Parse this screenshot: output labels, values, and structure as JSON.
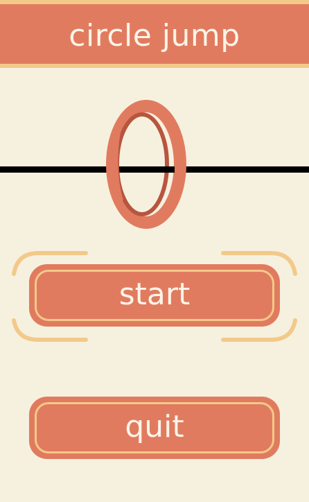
{
  "header": {
    "title": "circle jump"
  },
  "menu": {
    "start_label": "start",
    "quit_label": "quit",
    "selected": "start"
  },
  "colors": {
    "background": "#f6f1df",
    "accent": "#e17b5f",
    "highlight": "#f3c98a",
    "text": "#fbf4e8",
    "line": "#000000"
  }
}
